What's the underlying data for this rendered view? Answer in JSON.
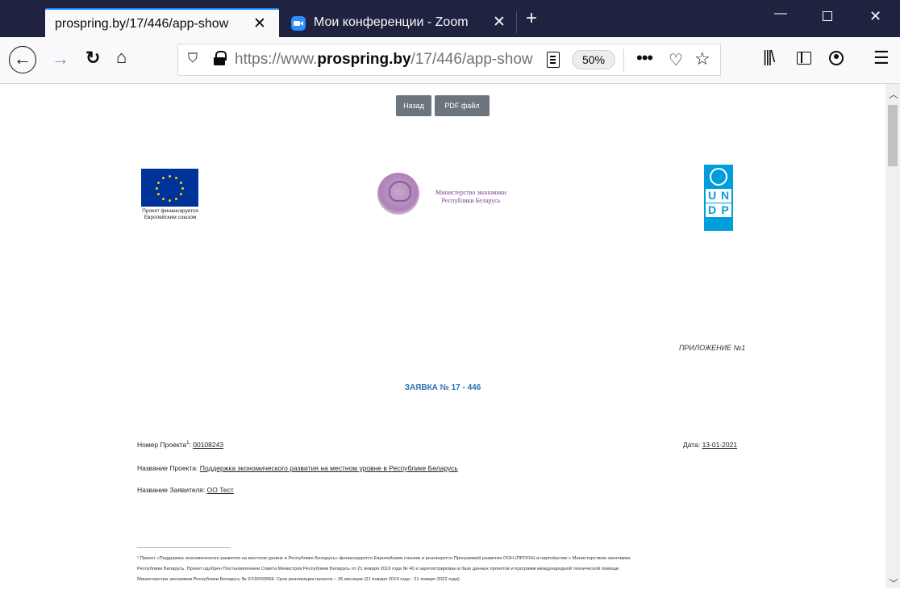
{
  "browser": {
    "tabs": [
      {
        "title": "prospring.by/17/446/app-show",
        "active": true
      },
      {
        "title": "Мои конференции - Zoom",
        "active": false
      }
    ],
    "url": {
      "domain": "https://www.",
      "host": "prospring.by",
      "path": "/17/446/app-show"
    },
    "zoom": "50%"
  },
  "page": {
    "buttons": {
      "back": "Назад",
      "pdf": "PDF файл"
    },
    "eu_caption": "Проект финансируется Европейским союзом",
    "ministry": "Министерство экономики Республики Беларусь",
    "undp_letters": [
      "U",
      "N",
      "D",
      "P"
    ],
    "annex": "ПРИЛОЖЕНИЕ №1",
    "app_title": "ЗАЯВКА № 17 - 446",
    "project_number_label": "Номер Проекта",
    "project_number_sup": "1",
    "project_number_value": "00108243",
    "date_label": "Дата:",
    "date_value": "13-01-2021",
    "project_name_label": "Название Проекта:",
    "project_name_value": "Поддержка экономического развития на местном уровне в Республике Беларусь",
    "applicant_label": "Название Заявителя:",
    "applicant_value": "ОО Тест",
    "footnote_lines": [
      "¹ Проект «Поддержка экономического развития на местном уровне в Республике Беларусь» финансируется Европейским союзом и реализуется Программой развития ООН (ПРООН) в партнёрстве с Министерством экономики",
      "Республики Беларусь. Проект одобрен Постановлением Совета Министров Республики Беларусь от 21 января 2019 года № 40 и зарегистрирован в базе данных проектов и программ международной технической помощи",
      "Министерства экономики Республики Беларусь № 2/19/000968. Срок реализации проекта – 36 месяцев (21 января 2019 года - 21 января 2022 года)"
    ]
  },
  "colors": {
    "accent_title": "#2c6fb3",
    "ministry": "#7b3c8c",
    "undp": "#009edb",
    "eu": "#003399"
  }
}
